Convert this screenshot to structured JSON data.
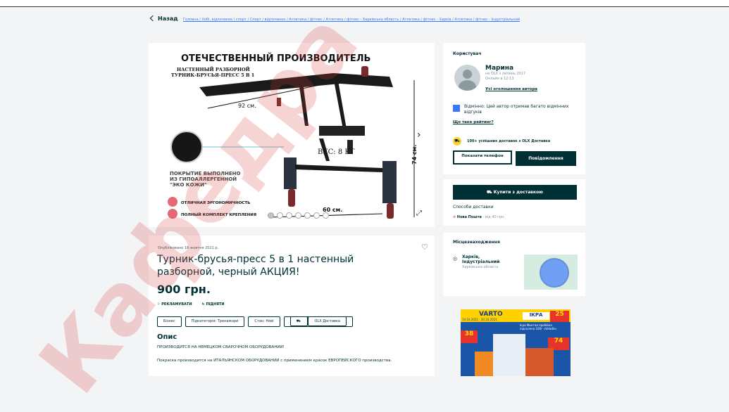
{
  "nav": {
    "back_label": "Назад",
    "breadcrumbs": "Головна / Хобі, відпочинок і спорт / Спорт / відпочинок / Атлетика / фітнес / Атлетика / фітнес - Харківська область / Атлетика / фітнес - Харків / Атлетика / фітнес - Індустріальний"
  },
  "photo": {
    "banner_title": "ОТЕЧЕСТВЕННЫЙ ПРОИЗВОДИТЕЛЬ",
    "subtitle1": "НАСТЕННЫЙ РАЗБОРНОЙ",
    "subtitle2": "ТУРНИК-БРУСЬЯ-ПРЕСС 5 В 1",
    "dim1": "92 см.",
    "dim2": "60 см.",
    "dim3": "74 см.",
    "weight": "ВЕС: 8 КГ",
    "coating": "ПОКРЫТИЕ ВЫПОЛНЕНО ИЗ ГИПОАЛЛЕРГЕННОЙ \"ЭКО КОЖИ\"",
    "feature1": "ОТЛИЧНАЯ ЭРГОНОМИЧНОСТЬ",
    "feature2": "ПОЛНЫЙ КОМПЛЕКТ КРЕПЛЕНИЯ",
    "next_icon": "chevron-right-icon",
    "expand_icon": "expand-icon",
    "dots_count": 7
  },
  "listing": {
    "posted": "Опубліковано 18 жовтня 2021 р.",
    "title": "Турник-брусья-пресс 5 в 1 настенный разборной, черный АКЦИЯ!",
    "price": "900 грн.",
    "promote": "РЕКЛАМУВАТИ",
    "raise": "ПІДНЯТИ",
    "tags": [
      "Бізнес",
      "Підкатегорія: Тренажори",
      "Стан: Нові",
      "OLX Доставка"
    ],
    "desc_heading": "Опис",
    "desc_line1": "ПРОИЗВОДИТСЯ НА НЕМЕЦКОМ СВАРОЧНОМ ОБОРУДОВАНИИ!",
    "desc_line2": "Покраска производится на ИТАЛЬЯНСКОМ ОБОРУДОВАНИИ с применением красок ЕВРОПЕЙСКОГО производства."
  },
  "user": {
    "heading": "Користувач",
    "name": "Марина",
    "since": "на OLX з липень 2017",
    "online": "Онлайн в 12:13",
    "all_ads": "Усі оголошення автора",
    "rating_text": "Відмінно: Цей автор отримав багато відмінних відгуків",
    "rating_link": "Що таке рейтинг?",
    "deliveries": "100+ успішних доставок з OLX Доставка",
    "show_phone": "Показати телефон",
    "message": "Повідомлення"
  },
  "delivery": {
    "buy_button": "Купити з доставкою",
    "methods_heading": "Способи доставки",
    "carrier": "Нова Пошта",
    "carrier_price": "- від 40 грн."
  },
  "location": {
    "heading": "Місцезнаходження",
    "city": "Харків, Індустріальний",
    "region": "Харківська область"
  },
  "ad": {
    "brand": "VARTO",
    "dates": "14.10.2021 - 20.10.2021",
    "product": "ІКРА",
    "price1": "25",
    "price2": "38",
    "price3": "74",
    "note": "Ікра Минтая пробійна підсолена 100г «Veladis»"
  },
  "watermark": "Кафедра"
}
